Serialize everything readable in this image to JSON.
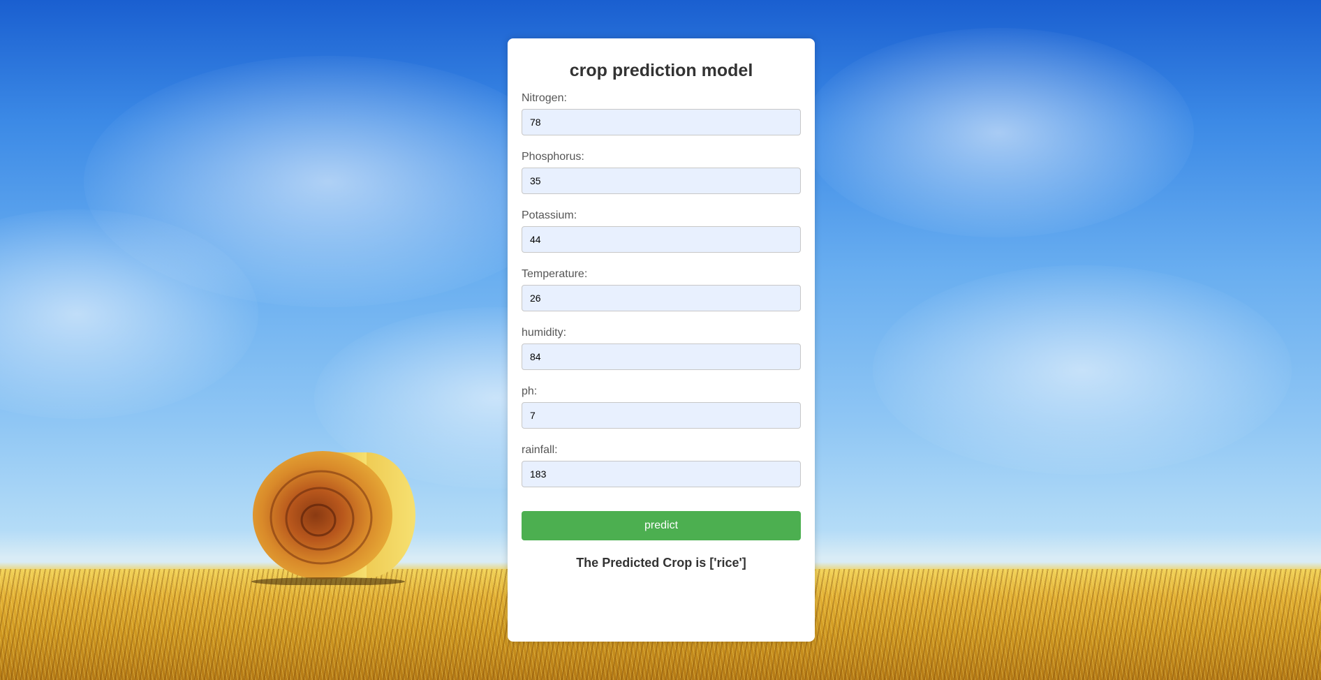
{
  "page": {
    "title": "crop prediction model",
    "background_image": "hay-bale-in-wheat-field-under-blue-sky"
  },
  "form": {
    "fields": [
      {
        "label": "Nitrogen:",
        "value": "78"
      },
      {
        "label": "Phosphorus:",
        "value": "35"
      },
      {
        "label": "Potassium:",
        "value": "44"
      },
      {
        "label": "Temperature:",
        "value": "26"
      },
      {
        "label": "humidity:",
        "value": "84"
      },
      {
        "label": "ph:",
        "value": "7"
      },
      {
        "label": "rainfall:",
        "value": "183"
      }
    ],
    "submit_label": "predict"
  },
  "result": {
    "text": "The Predicted Crop is ['rice']"
  },
  "colors": {
    "button": "#4caf50",
    "input_background": "#e8f0fe",
    "card_background": "#ffffff",
    "text": "#333333"
  }
}
